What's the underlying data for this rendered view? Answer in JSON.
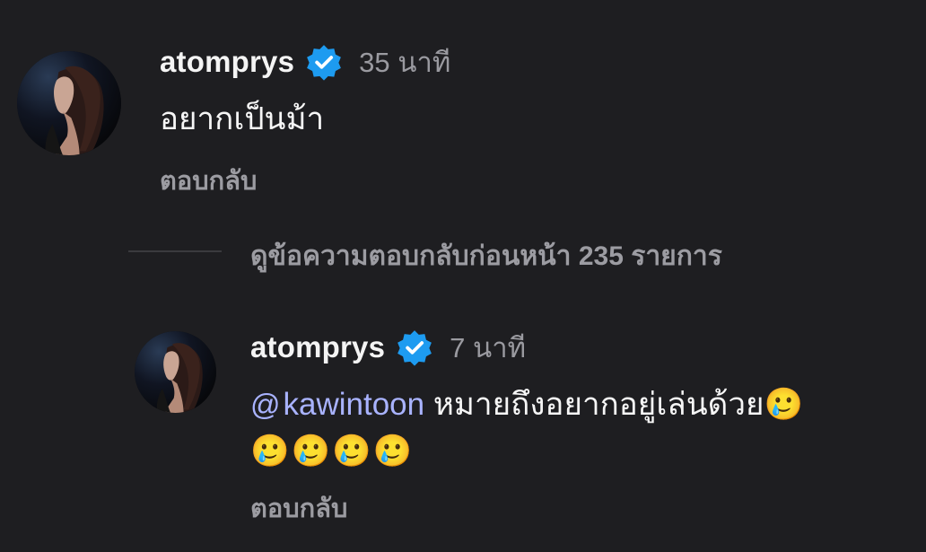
{
  "colors": {
    "background": "#1e1e21",
    "text_primary": "#f4f4f4",
    "text_secondary": "#9c9ca2",
    "mention": "#a9b3ff",
    "verified_badge": "#1d9bf0"
  },
  "comments": [
    {
      "avatar_icon": "profile-photo",
      "username": "atomprys",
      "verified_icon": "verified-badge-icon",
      "timestamp": "35 นาที",
      "text": "อยากเป็นม้า",
      "reply_label": "ตอบกลับ"
    },
    {
      "avatar_icon": "profile-photo",
      "username": "atomprys",
      "verified_icon": "verified-badge-icon",
      "timestamp": "7 นาที",
      "mention_icon": "threads-at-icon",
      "mention_symbol": "@",
      "mention": "kawintoon",
      "text": " หมายถึงอยากอยู่เล่นด้วย🥲",
      "emoji_line": "🥲🥲🥲🥲",
      "reply_label": "ตอบกลับ"
    }
  ],
  "view_previous_replies": "ดูข้อความตอบกลับก่อนหน้า 235 รายการ"
}
